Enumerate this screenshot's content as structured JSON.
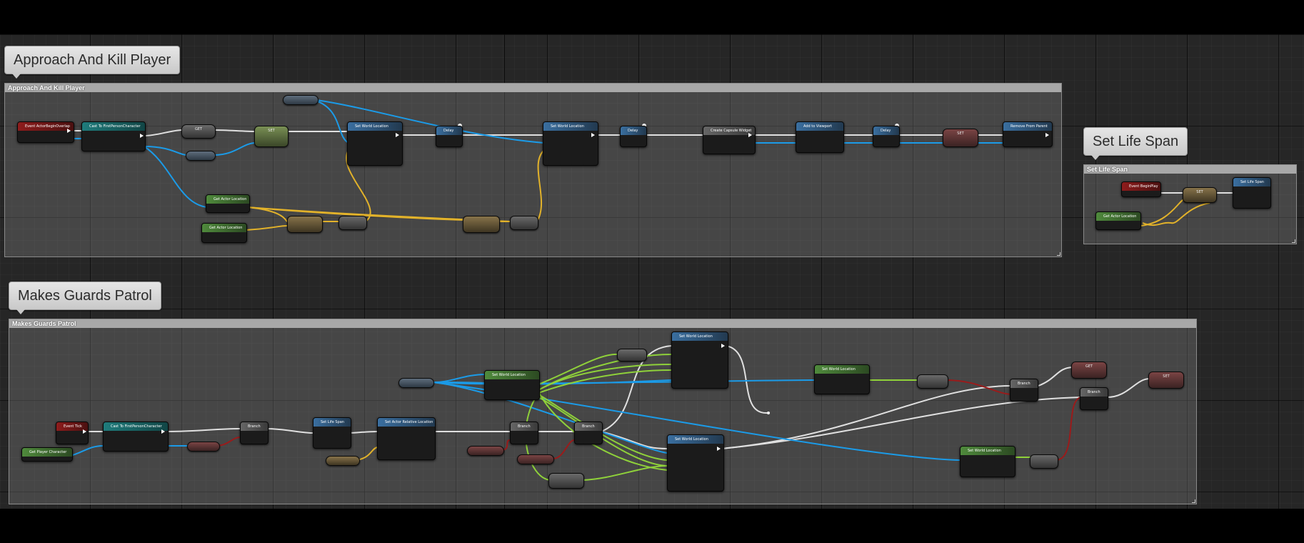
{
  "wire_colors": {
    "exec": "#e6e6e6",
    "object": "#1b9be8",
    "vector": "#e2b22a",
    "float": "#8fd13a",
    "bool": "#9a1b1b"
  },
  "comments": [
    {
      "bubble": "Approach And Kill Player",
      "header": "Approach And Kill Player"
    },
    {
      "bubble": "Set Life Span",
      "header": "Set Life Span"
    },
    {
      "bubble": "Makes Guards Patrol",
      "header": "Makes Guards Patrol"
    }
  ],
  "nodes": {
    "a": [
      "Event ActorBeginOverlap",
      "Cast To FirstPersonCharacter",
      "GET",
      "",
      "SET",
      "Set World Location",
      "Delay",
      "Set World Location",
      "Delay",
      "Create Capsule Widget",
      "Add to Viewport",
      "Delay",
      "SET",
      "Remove From Parent",
      "Get Actor Location",
      "Get Actor Location",
      "",
      "",
      "",
      ""
    ],
    "b": [
      "Event BeginPlay",
      "SET",
      "Set Life Span",
      "Get Actor Location"
    ],
    "c": [
      "Event Tick",
      "Get Player Character",
      "Cast To FirstPersonCharacter",
      "Branch",
      "Set Life Span",
      "Set Actor Relative Location",
      "Branch",
      "Branch",
      "Set World Location",
      "Set World Location",
      "Set World Location",
      "Set World Location",
      "Set World Location",
      "Branch",
      "Branch",
      "GET",
      "SET",
      "",
      "",
      ""
    ]
  }
}
